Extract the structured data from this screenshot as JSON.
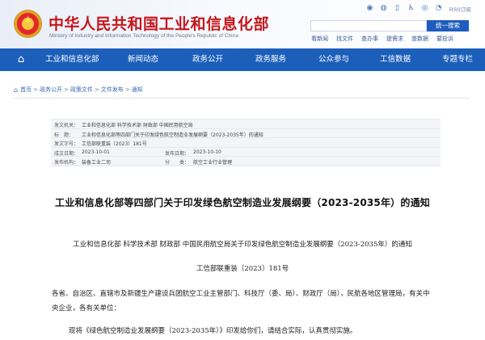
{
  "header": {
    "title_cn": "中华人民共和国工业和信息化部",
    "title_en": "Ministry of Industry and Information Technology of the People's Republic of China",
    "rss_label": "RSS订阅",
    "search_placeholder": "",
    "search_button": "统一搜索",
    "quick_links": [
      "看新闻",
      "找文件",
      "查办事",
      "提需求",
      "查数据",
      "要投诉"
    ],
    "icons": [
      "weibo-icon",
      "wechat-icon",
      "mobile-icon",
      "accessibility-icon",
      "english-icon",
      "rss-icon"
    ]
  },
  "nav": {
    "items": [
      "工业和信息化部",
      "新闻动态",
      "政务公开",
      "政务服务",
      "公众参与",
      "工信数据",
      "专题专栏"
    ]
  },
  "breadcrumb": {
    "items": [
      "首页",
      "政务公开",
      "政策文件",
      "文件发布",
      "通知"
    ],
    "separator": ">"
  },
  "info": {
    "rows": [
      {
        "k": "发文机关：",
        "v": "工业和信息化部 科学技术部 财政部 中国民用航空局"
      },
      {
        "k": "标　题：",
        "v": "工业和信息化部等四部门关于印发绿色航空制造业发展纲要（2023-2035年）的通知"
      },
      {
        "k": "发文字号：",
        "v": "工信部联重装〔2023〕181号"
      },
      {
        "k": "成文日期：",
        "v": "2023-10-01",
        "k2": "发布日期：",
        "v2": "2023-10-10"
      },
      {
        "k": "发布机构：",
        "v": "装备工业二司",
        "k2": "分　　类：",
        "v2": "航空工业行业管理"
      }
    ]
  },
  "document": {
    "title": "工业和信息化部等四部门关于印发绿色航空制造业发展纲要（2023-2035年）的通知",
    "subtitle": "工业和信息化部 科学技术部 财政部 中国民用航空局关于印发绿色航空制造业发展纲要（2023-2035年）的通知",
    "doc_number": "工信部联重装〔2023〕181号",
    "recipients_line1": "各省、自治区、直辖市及新疆生产建设兵团航空工业主管部门、科技厅（委、局）、财政厅（局），民航各地区管理局，有关中",
    "recipients_line2": "央企业，各有关单位：",
    "body_line1": "现将《绿色航空制造业发展纲要（2023-2035年）》印发给你们，请结合实际，认真贯彻实施。"
  },
  "colors": {
    "brand_red": "#c4161c",
    "nav_blue": "#1c5fbb",
    "link_blue": "#3b66b5"
  }
}
